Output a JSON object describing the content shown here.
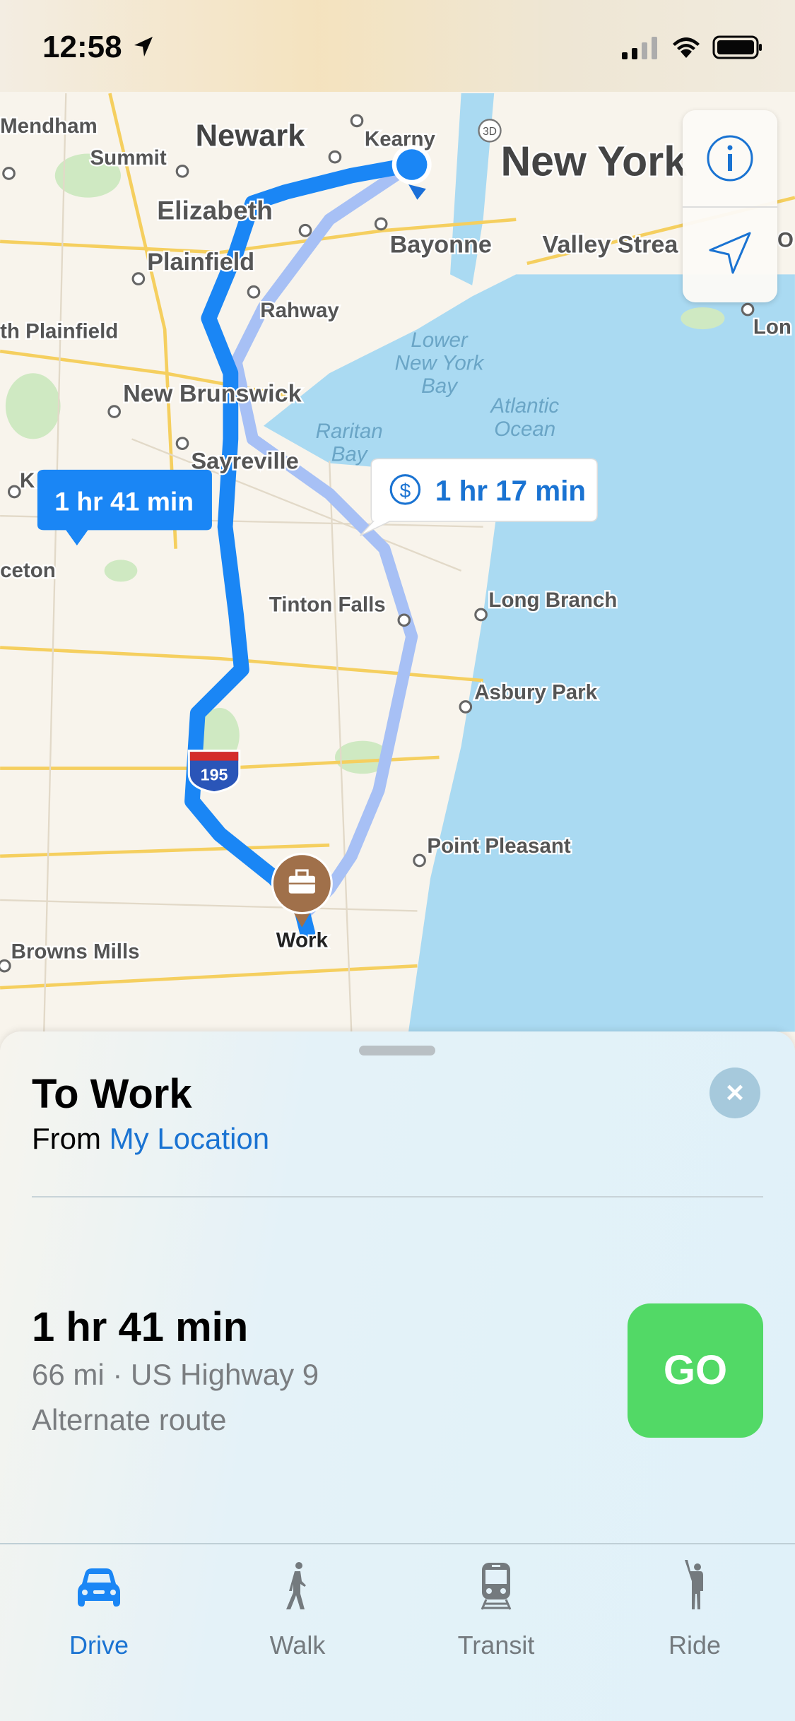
{
  "status_bar": {
    "time": "12:58",
    "icons": [
      "location-arrow-icon",
      "signal-icon",
      "wifi-icon",
      "battery-icon"
    ]
  },
  "map": {
    "labels": {
      "mendham": "Mendham",
      "newark": "Newark",
      "kearny": "Kearny",
      "new_york": "New York",
      "summit": "Summit",
      "elizabeth": "Elizabeth",
      "bayonne": "Bayonne",
      "valley_stream": "Valley Strea",
      "plainfield": "Plainfield",
      "rahway": "Rahway",
      "south_plainfield": "th Plainfield",
      "lower_ny_bay_1": "Lower",
      "lower_ny_bay_2": "New York",
      "lower_ny_bay_3": "Bay",
      "new_brunswick": "New Brunswick",
      "atlantic_1": "Atlantic",
      "atlantic_2": "Ocean",
      "raritan_1": "Raritan",
      "raritan_2": "Bay",
      "sayreville": "Sayreville",
      "k": "K",
      "princeton": "ceton",
      "tinton_falls": "Tinton Falls",
      "long_branch": "Long Branch",
      "asbury_park": "Asbury Park",
      "point_pleasant": "Point Pleasant",
      "browns_mills": "Browns Mills",
      "long": "Lon",
      "o": "O",
      "three_d": "3D"
    },
    "route_primary_time": "1 hr 41 min",
    "route_alt_time": "1 hr 17 min",
    "toll_icon": "$",
    "interstate": "195",
    "destination": "Work",
    "buttons": {
      "info": "info-icon",
      "tracking": "location-arrow-icon"
    },
    "colors": {
      "route": "#1a86f5",
      "alt_route": "#a7c0f5",
      "water": "#aadaf2",
      "land": "#f8f4ec",
      "pin": "#a0704a"
    }
  },
  "sheet": {
    "title": "To Work",
    "from_prefix": "From",
    "from_location": "My Location",
    "close_label": "×",
    "route": {
      "duration": "1 hr 41 min",
      "distance": "66 mi · US Highway 9",
      "note": "Alternate route"
    },
    "go_label": "GO",
    "go_color": "#52d966"
  },
  "tabs": [
    {
      "label": "Drive",
      "icon": "car-icon",
      "active": true
    },
    {
      "label": "Walk",
      "icon": "walk-icon",
      "active": false
    },
    {
      "label": "Transit",
      "icon": "train-icon",
      "active": false
    },
    {
      "label": "Ride",
      "icon": "ride-icon",
      "active": false
    }
  ]
}
